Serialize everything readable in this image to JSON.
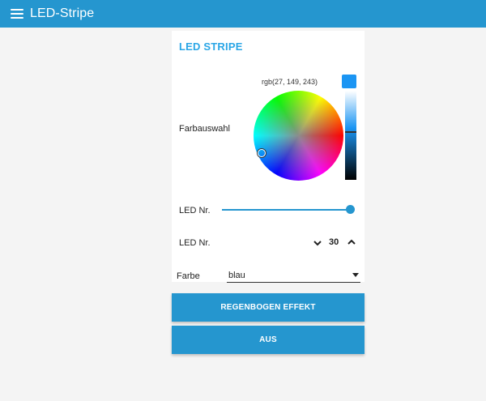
{
  "appbar": {
    "title": "LED-Stripe"
  },
  "card": {
    "title": "LED STRIPE"
  },
  "color_picker": {
    "label": "Farbauswahl",
    "rgb_text": "rgb(27, 149, 243)",
    "selected_color": "#1b95f3"
  },
  "slider": {
    "label": "LED Nr.",
    "value_fraction": 1.0
  },
  "numeric": {
    "label": "LED Nr.",
    "value": "30"
  },
  "dropdown": {
    "label": "Farbe",
    "value": "blau"
  },
  "buttons": {
    "rainbow": "REGENBOGEN EFFEKT",
    "off": "AUS"
  },
  "colors": {
    "accent": "#2596cf",
    "title": "#2aa6e6",
    "background": "#f4f4f4"
  }
}
